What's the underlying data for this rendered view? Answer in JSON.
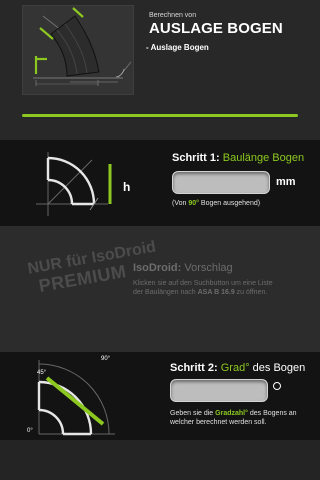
{
  "header": {
    "subtitle": "Berechnen von",
    "title": "AUSLAGE BOGEN",
    "item": "- Auslage Bogen"
  },
  "step1": {
    "title_prefix": "Schritt 1:",
    "title_accent": "Baulänge Bogen",
    "diagram_label": "h",
    "input_value": "",
    "unit": "mm",
    "note_before": "(Von",
    "note_accent": "90°",
    "note_after": "Bogen ausgehend)"
  },
  "premium": {
    "stamp_line1": "NUR für IsoDroid",
    "stamp_line2": "PREMIUM",
    "title_bold": "IsoDroid:",
    "title_light": "Vorschlag",
    "desc_before": "Klicken sie auf den Suchbutton um eine Liste der Baulängen nach",
    "desc_bold": "ASA B 16.9",
    "desc_after": "zu öffnen."
  },
  "step2": {
    "title_prefix": "Schritt 2:",
    "title_accent": "Grad°",
    "title_suffix": "des Bogen",
    "input_value": "",
    "unit_icon": "degree-circle",
    "angle_label_0": "0°",
    "angle_label_45": "45°",
    "angle_label_90": "90°",
    "note_before": "Geben sie die",
    "note_accent": "Gradzahl°",
    "note_after": "des Bogens an welcher berechnet werden soll."
  },
  "colors": {
    "accent": "#8cc820",
    "background": "#262626",
    "band_dark": "#131313",
    "input_fill": "#bdbdbd"
  }
}
